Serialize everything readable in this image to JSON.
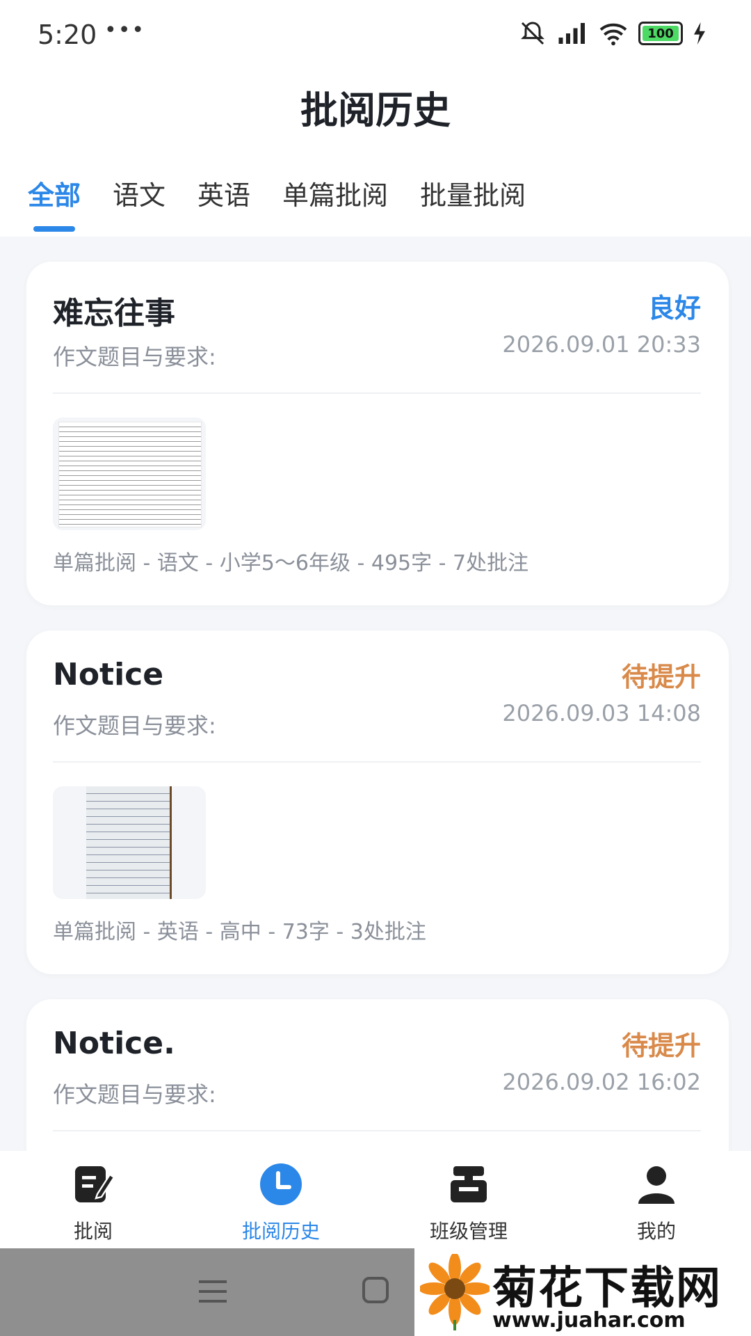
{
  "status_bar": {
    "time": "5:20",
    "dots": "•••",
    "battery": "100"
  },
  "header": {
    "title": "批阅历史"
  },
  "tabs": [
    {
      "label": "全部",
      "active": true
    },
    {
      "label": "语文"
    },
    {
      "label": "英语"
    },
    {
      "label": "单篇批阅"
    },
    {
      "label": "批量批阅"
    }
  ],
  "cards": [
    {
      "title": "难忘往事",
      "grade": "良好",
      "subtitle": "作文题目与要求:",
      "date": "2026.09.01 20:33",
      "meta": "单篇批阅 - 语文 - 小学5～6年级 - 495字 - 7处批注"
    },
    {
      "title": "Notice",
      "grade": "待提升",
      "subtitle": "作文题目与要求:",
      "date": "2026.09.03 14:08",
      "meta": "单篇批阅 - 英语 - 高中 - 73字 - 3处批注"
    },
    {
      "title": "Notice.",
      "grade": "待提升",
      "subtitle": "作文题目与要求:",
      "date": "2026.09.02 16:02"
    }
  ],
  "bottom_nav": [
    {
      "label": "批阅",
      "icon": "edit-document-icon"
    },
    {
      "label": "批阅历史",
      "icon": "clock-icon",
      "active": true
    },
    {
      "label": "班级管理",
      "icon": "class-manage-icon"
    },
    {
      "label": "我的",
      "icon": "user-icon"
    }
  ],
  "watermark": {
    "title": "菊花下载网",
    "url": "www.juahar.com"
  },
  "colors": {
    "accent": "#2b87e8",
    "grade_good": "#2b87e8",
    "grade_improve": "#d98a4a"
  }
}
